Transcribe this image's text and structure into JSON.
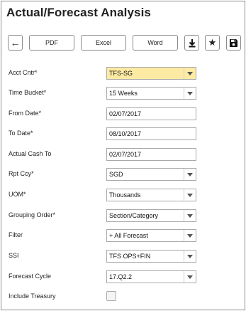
{
  "title": "Actual/Forecast Analysis",
  "toolbar": {
    "back_glyph": "←",
    "pdf_label": "PDF",
    "excel_label": "Excel",
    "word_label": "Word",
    "download_glyph": "⬇",
    "star_glyph": "★",
    "save_icon": "floppy-disk-icon"
  },
  "form": {
    "acct_cntr": {
      "label": "Acct Cntr*",
      "value": "TFS-SG"
    },
    "time_bucket": {
      "label": "Time Bucket*",
      "value": "15 Weeks"
    },
    "from_date": {
      "label": "From Date*",
      "value": "02/07/2017"
    },
    "to_date": {
      "label": "To Date*",
      "value": "08/10/2017"
    },
    "actual_cash_to": {
      "label": "Actual Cash To",
      "value": "02/07/2017"
    },
    "rpt_ccy": {
      "label": "Rpt Ccy*",
      "value": "SGD"
    },
    "uom": {
      "label": "UOM*",
      "value": "Thousands"
    },
    "grouping_order": {
      "label": "Grouping Order*",
      "value": "Section/Category"
    },
    "filter": {
      "label": "Filter",
      "value": "+ All Forecast"
    },
    "ssi": {
      "label": "SSI",
      "value": "TFS OPS+FIN"
    },
    "forecast_cycle": {
      "label": "Forecast Cycle",
      "value": "17.Q2.2"
    },
    "include_treasury": {
      "label": "Include Treasury",
      "checked": false
    }
  },
  "colors": {
    "highlight": "#fdeaa3",
    "border": "#a9a9a9"
  }
}
